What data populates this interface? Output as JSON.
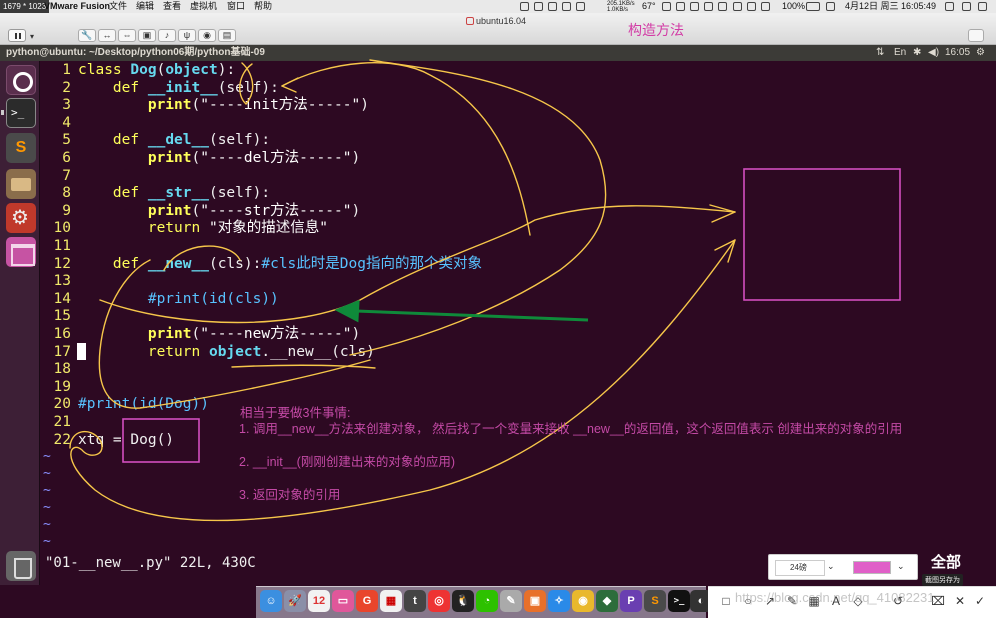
{
  "menubar": {
    "dimensions_badge": "1679 * 1023",
    "app_name": "VMware Fusion",
    "menus": [
      "文件",
      "编辑",
      "查看",
      "虚拟机",
      "窗口",
      "帮助"
    ],
    "net_speed_up": "205.1KB/s",
    "net_speed_down": "1.0KB/s",
    "temperature": "67°",
    "battery": "100%",
    "datetime": "4月12日 周三  16:05:49"
  },
  "vm_window": {
    "title": "ubuntu16.04",
    "chapter_overlay_title": "构造方法"
  },
  "ubuntu_panel": {
    "terminal_title": "python@ubuntu: ~/Desktop/python06期/python基础-09",
    "clock": "16:05"
  },
  "code": {
    "lines": [
      {
        "no": "1",
        "text": "class Dog(object):"
      },
      {
        "no": "2",
        "text": "    def __init__(self):"
      },
      {
        "no": "3",
        "text": "        print(\"----init方法-----\")"
      },
      {
        "no": "4",
        "text": ""
      },
      {
        "no": "5",
        "text": "    def __del__(self):"
      },
      {
        "no": "6",
        "text": "        print(\"----del方法-----\")"
      },
      {
        "no": "7",
        "text": ""
      },
      {
        "no": "8",
        "text": "    def __str__(self):"
      },
      {
        "no": "9",
        "text": "        print(\"----str方法-----\")"
      },
      {
        "no": "10",
        "text": "        return \"对象的描述信息\""
      },
      {
        "no": "11",
        "text": ""
      },
      {
        "no": "12",
        "text": "    def __new__(cls):#cls此时是Dog指向的那个类对象"
      },
      {
        "no": "13",
        "text": ""
      },
      {
        "no": "14",
        "text": "        #print(id(cls))"
      },
      {
        "no": "15",
        "text": ""
      },
      {
        "no": "16",
        "text": "        print(\"----new方法-----\")"
      },
      {
        "no": "17",
        "text": "        return object.__new__(cls)"
      },
      {
        "no": "18",
        "text": ""
      },
      {
        "no": "19",
        "text": ""
      },
      {
        "no": "20",
        "text": "#print(id(Dog))"
      },
      {
        "no": "21",
        "text": ""
      },
      {
        "no": "22",
        "text": "xtq = Dog()"
      }
    ],
    "status_line": "\"01-__new__.py\" 22L, 430C"
  },
  "annotations": {
    "intro": "相当于要做3件事情:",
    "step1": "1. 调用__new__方法来创建对象， 然后找了一个变量来接收 __new__的返回值，这个返回值表示 创建出来的对象的引用",
    "step2": "2. __init__(刚刚创建出来的对象的应用)",
    "step3": "3. 返回对象的引用",
    "pen_color": "#f6c64a",
    "box_color": "#d24fbf",
    "arrow_color": "#0f8a3a"
  },
  "annot_toolbar": {
    "font_size": "24磅",
    "color": "#e060c8",
    "all_label": "全部",
    "save_as_tooltip": "截图另存为"
  },
  "watermark": "https://blog.csdn.net/qq_41082231",
  "dock_icons": [
    "finder-icon",
    "launchpad-icon",
    "calendar-icon",
    "screen-icon",
    "weibo-icon",
    "text-icon",
    "toutiao-icon",
    "netease-music-icon",
    "qq-icon",
    "wechat-icon",
    "preview-icon",
    "vmware-icon",
    "safari-icon",
    "chrome-icon",
    "python-icon",
    "pycharm-icon",
    "sublime-icon",
    "terminal-icon",
    "obs-icon"
  ]
}
